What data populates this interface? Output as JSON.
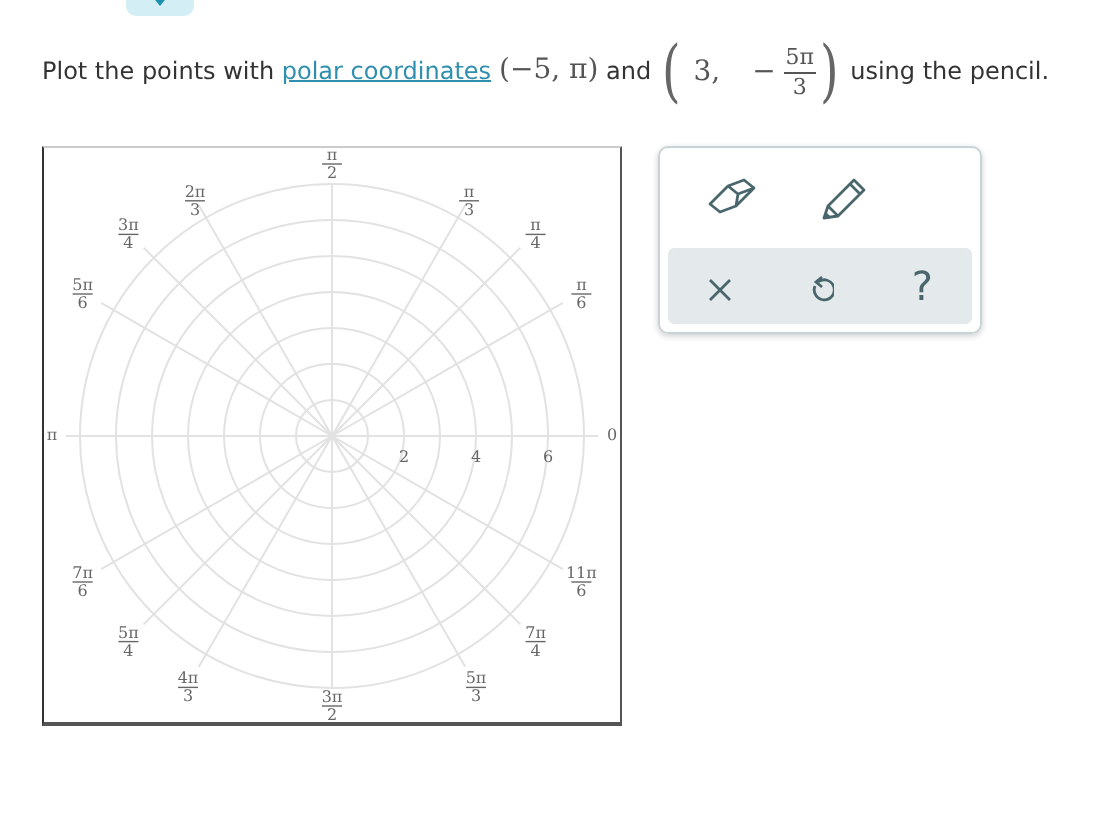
{
  "instruction": {
    "before": "Plot the points with ",
    "link": "polar coordinates",
    "point_1": "(−5,  π)",
    "middle": "and",
    "point_2": {
      "open": "(",
      "close": ")",
      "first": "3,",
      "sign": "−",
      "numerator": "5π",
      "denominator": "3"
    },
    "after": "using the pencil."
  },
  "polar_grid": {
    "angle_labels": [
      {
        "numerator": "0"
      },
      {
        "numerator": "π",
        "denominator": "6"
      },
      {
        "numerator": "π",
        "denominator": "4"
      },
      {
        "numerator": "π",
        "denominator": "3"
      },
      {
        "numerator": "π",
        "denominator": "2"
      },
      {
        "numerator": "2π",
        "denominator": "3"
      },
      {
        "numerator": "3π",
        "denominator": "4"
      },
      {
        "numerator": "5π",
        "denominator": "6"
      },
      {
        "numerator": "π"
      },
      {
        "numerator": "7π",
        "denominator": "6"
      },
      {
        "numerator": "5π",
        "denominator": "4"
      },
      {
        "numerator": "4π",
        "denominator": "3"
      },
      {
        "numerator": "3π",
        "denominator": "2"
      },
      {
        "numerator": "5π",
        "denominator": "3"
      },
      {
        "numerator": "7π",
        "denominator": "4"
      },
      {
        "numerator": "11π",
        "denominator": "6"
      }
    ],
    "radius_labels": [
      "2",
      "4",
      "6"
    ]
  },
  "tools": [
    {
      "kind": "eraser",
      "selected": false
    },
    {
      "kind": "pencil",
      "selected": false
    }
  ],
  "actions": [
    {
      "kind": "clear"
    },
    {
      "kind": "undo"
    },
    {
      "kind": "help",
      "label": "?"
    }
  ]
}
